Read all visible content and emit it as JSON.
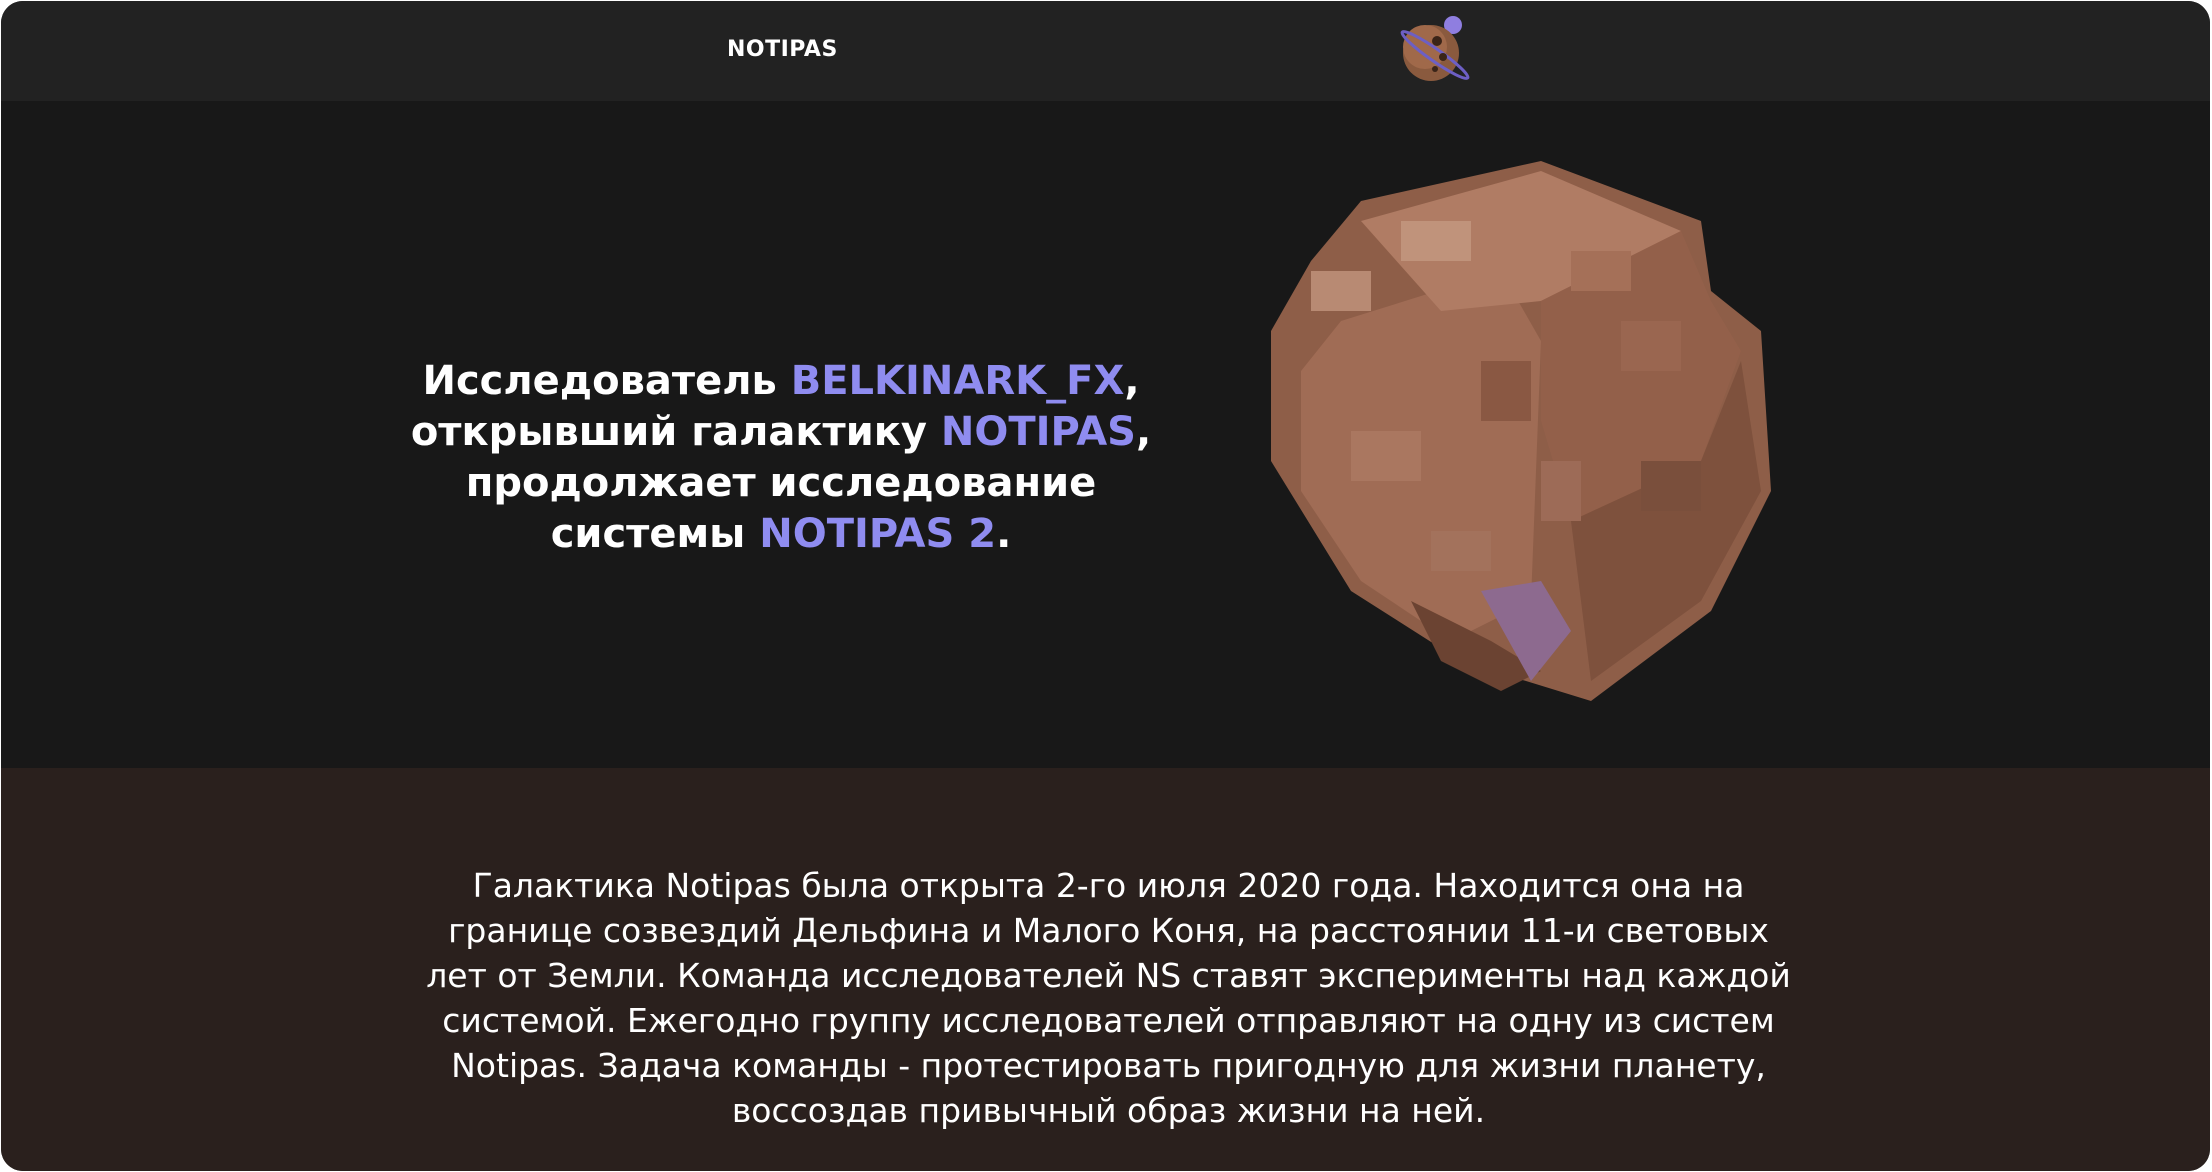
{
  "nav": {
    "brand": "NOTIPAS",
    "logo_icon": "planet-logo-icon"
  },
  "hero": {
    "line1_prefix": "Исследователь ",
    "line1_accent": "BELKINARK_FX",
    "line1_suffix": ",",
    "line2_prefix": "открывший галактику ",
    "line2_accent": "NOTIPAS",
    "line2_suffix": ",",
    "line3": "продолжает исследование",
    "line4_prefix": "системы ",
    "line4_accent": "NOTIPAS 2",
    "line4_suffix": ".",
    "image_icon": "voxel-planet-image"
  },
  "about": {
    "text": "Галактика Notipas была открыта 2-го июля 2020 года. Находится она на границе созвездий Дельфина и Малого Коня, на расстоянии 11-и световых лет от Земли. Команда исследователей NS ставят эксперименты над каждой системой. Ежегодно группу исследователей отправляют на одну из систем Notipas. Задача команды - протестировать пригодную для жизни планету, воссоздав привычный образ жизни на ней."
  },
  "colors": {
    "background": "#181818",
    "topbar": "#222222",
    "accent": "#8f8cf0",
    "about_background": "#2a201d",
    "planet": "#a06c55"
  }
}
